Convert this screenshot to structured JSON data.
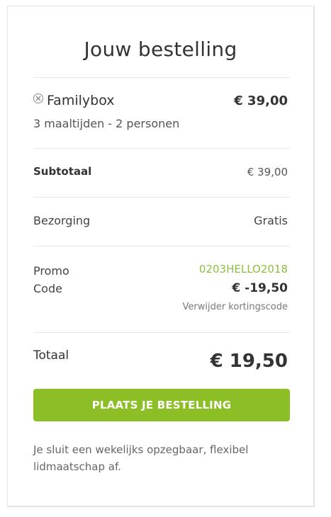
{
  "order": {
    "title": "Jouw bestelling",
    "product": {
      "name": "Familybox",
      "price": "€ 39,00",
      "description": "3 maaltijden - 2 personen",
      "remove_icon": "circle-x-icon"
    },
    "subtotal": {
      "label": "Subtotaal",
      "value": "€ 39,00"
    },
    "shipping": {
      "label": "Bezorging",
      "value": "Gratis"
    },
    "promo": {
      "label": "Promo Code",
      "code": "0203HELLO2018",
      "amount": "€ -19,50",
      "remove_label": "Verwijder kortingscode"
    },
    "total": {
      "label": "Totaal",
      "value": "€ 19,50"
    },
    "place_order_label": "PLAATS JE BESTELLING",
    "footnote": "Je sluit een wekelijks opzegbaar, flexibel lidmaatschap af."
  },
  "colors": {
    "accent": "#8cbf26",
    "promo_code": "#8cbf3f",
    "border": "#e6e2dc"
  }
}
